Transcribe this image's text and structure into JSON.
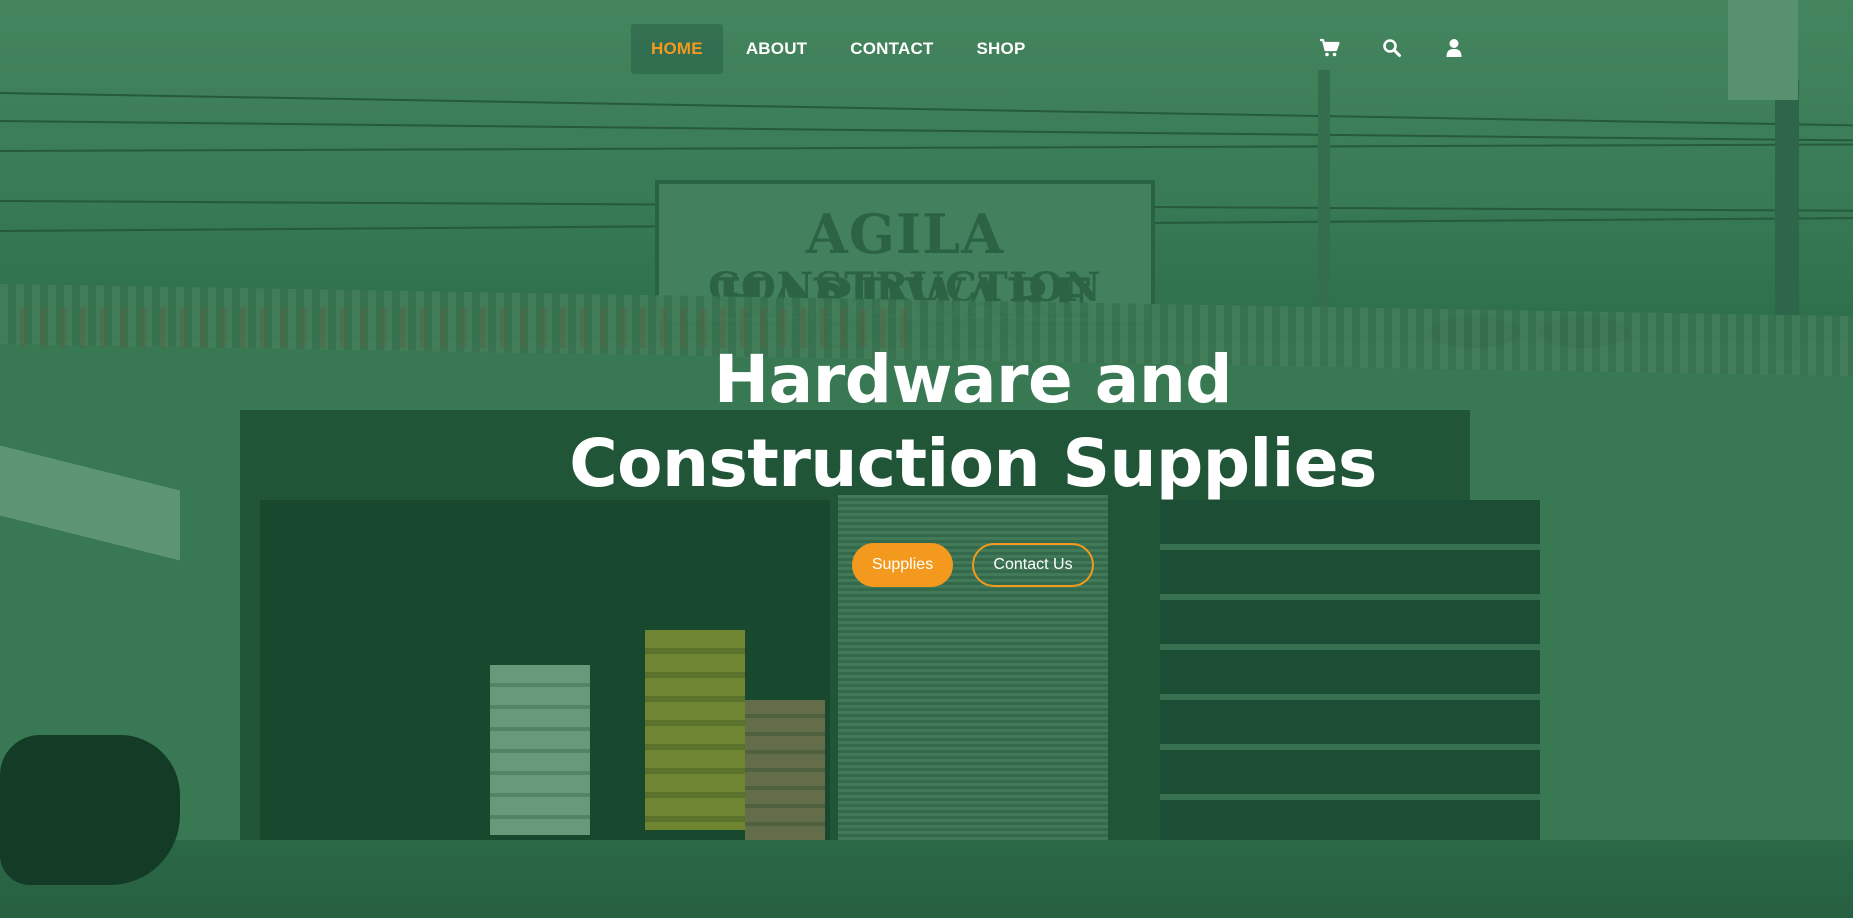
{
  "nav": {
    "items": [
      {
        "label": "HOME",
        "active": true
      },
      {
        "label": "ABOUT",
        "active": false
      },
      {
        "label": "CONTACT",
        "active": false
      },
      {
        "label": "SHOP",
        "active": false
      }
    ],
    "icons": [
      "cart-icon",
      "search-icon",
      "user-icon"
    ]
  },
  "hero": {
    "headline_line1": "Hardware and",
    "headline_line2": "Construction Supplies",
    "primary_button": "Supplies",
    "secondary_button": "Contact Us",
    "sign_line1": "AGILA HARDWARE",
    "sign_line2": "CONSTRUCTION SUPPLIES"
  },
  "colors": {
    "accent": "#f39a1e",
    "overlay": "#2f7a52",
    "text": "#ffffff"
  }
}
